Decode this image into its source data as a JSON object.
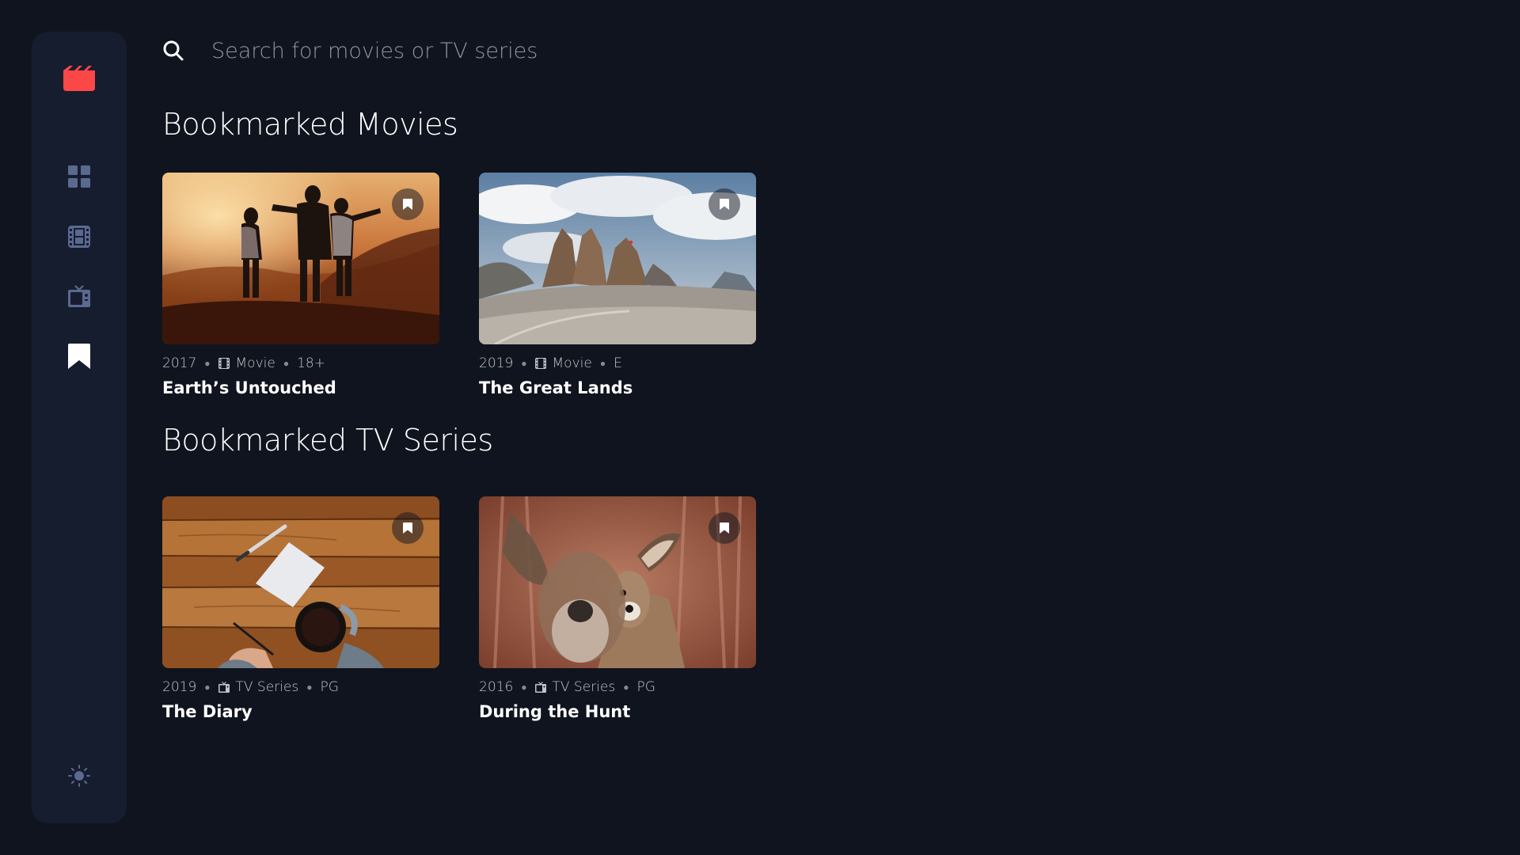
{
  "sidebar": {
    "logo_icon": "film-clapper-icon",
    "brand_color": "#FC4747",
    "nav": [
      {
        "id": "home",
        "icon": "grid-icon"
      },
      {
        "id": "movies",
        "icon": "film-icon"
      },
      {
        "id": "tv",
        "icon": "tv-icon"
      },
      {
        "id": "bookmarks",
        "icon": "bookmark-icon",
        "active": true
      }
    ],
    "theme_icon": "sun-icon"
  },
  "search": {
    "placeholder": "Search for movies or TV series",
    "value": ""
  },
  "sections": {
    "movies": {
      "title": "Bookmarked Movies",
      "items": [
        {
          "year": "2017",
          "category": "Movie",
          "rating": "18+",
          "title": "Earth’s Untouched",
          "bookmarked": true
        },
        {
          "year": "2019",
          "category": "Movie",
          "rating": "E",
          "title": "The Great Lands",
          "bookmarked": true
        }
      ]
    },
    "tv": {
      "title": "Bookmarked TV Series",
      "items": [
        {
          "year": "2019",
          "category": "TV Series",
          "rating": "PG",
          "title": "The Diary",
          "bookmarked": true
        },
        {
          "year": "2016",
          "category": "TV Series",
          "rating": "PG",
          "title": "During the Hunt",
          "bookmarked": true
        }
      ]
    }
  },
  "colors": {
    "background": "#10141E",
    "surface": "#161D2F",
    "nav_inactive": "#5A698F",
    "nav_active": "#FFFFFF",
    "accent": "#FC4747"
  }
}
